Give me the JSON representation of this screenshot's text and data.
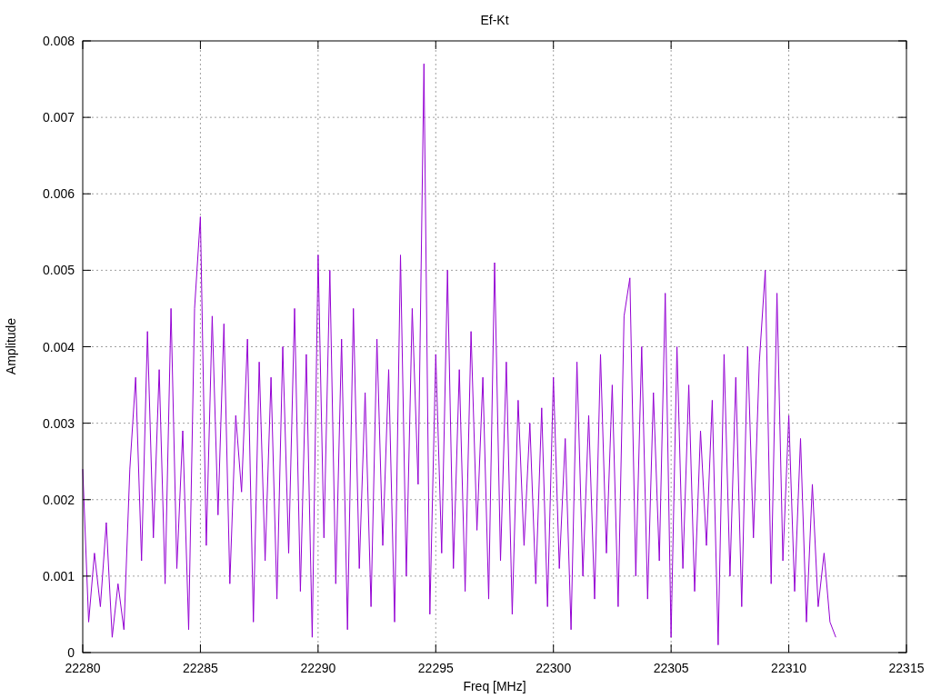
{
  "chart_data": {
    "type": "line",
    "title": "Ef-Kt",
    "xlabel": "Freq [MHz]",
    "ylabel": "Amplitude",
    "xlim": [
      22280,
      22315
    ],
    "ylim": [
      0,
      0.008
    ],
    "xticks": [
      22280,
      22285,
      22290,
      22295,
      22300,
      22305,
      22310,
      22315
    ],
    "yticks": [
      {
        "value": 0,
        "label": "0"
      },
      {
        "value": 0.001,
        "label": "0.001"
      },
      {
        "value": 0.002,
        "label": "0.002"
      },
      {
        "value": 0.003,
        "label": "0.003"
      },
      {
        "value": 0.004,
        "label": "0.004"
      },
      {
        "value": 0.005,
        "label": "0.005"
      },
      {
        "value": 0.006,
        "label": "0.006"
      },
      {
        "value": 0.007,
        "label": "0.007"
      },
      {
        "value": 0.008,
        "label": "0.008"
      }
    ],
    "grid": true,
    "x": [
      22280,
      22280.25,
      22280.5,
      22280.75,
      22281,
      22281.25,
      22281.5,
      22281.75,
      22282,
      22282.25,
      22282.5,
      22282.75,
      22283,
      22283.25,
      22283.5,
      22283.75,
      22284,
      22284.25,
      22284.5,
      22284.75,
      22285,
      22285.25,
      22285.5,
      22285.75,
      22286,
      22286.25,
      22286.5,
      22286.75,
      22287,
      22287.25,
      22287.5,
      22287.75,
      22288,
      22288.25,
      22288.5,
      22288.75,
      22289,
      22289.25,
      22289.5,
      22289.75,
      22290,
      22290.25,
      22290.5,
      22290.75,
      22291,
      22291.25,
      22291.5,
      22291.75,
      22292,
      22292.25,
      22292.5,
      22292.75,
      22293,
      22293.25,
      22293.5,
      22293.75,
      22294,
      22294.25,
      22294.5,
      22294.75,
      22295,
      22295.25,
      22295.5,
      22295.75,
      22296,
      22296.25,
      22296.5,
      22296.75,
      22297,
      22297.25,
      22297.5,
      22297.75,
      22298,
      22298.25,
      22298.5,
      22298.75,
      22299,
      22299.25,
      22299.5,
      22299.75,
      22300,
      22300.25,
      22300.5,
      22300.75,
      22301,
      22301.25,
      22301.5,
      22301.75,
      22302,
      22302.25,
      22302.5,
      22302.75,
      22303,
      22303.25,
      22303.5,
      22303.75,
      22304,
      22304.25,
      22304.5,
      22304.75,
      22305,
      22305.25,
      22305.5,
      22305.75,
      22306,
      22306.25,
      22306.5,
      22306.75,
      22307,
      22307.25,
      22307.5,
      22307.75,
      22308,
      22308.25,
      22308.5,
      22308.75,
      22309,
      22309.25,
      22309.5,
      22309.75,
      22310,
      22310.25,
      22310.5,
      22310.75,
      22311,
      22311.25,
      22311.5,
      22311.75,
      22312
    ],
    "series": [
      {
        "color": "#9400d3",
        "values": [
          0.0024,
          0.0004,
          0.0013,
          0.0006,
          0.0017,
          0.0002,
          0.0009,
          0.0003,
          0.0024,
          0.0036,
          0.0012,
          0.0042,
          0.0015,
          0.0037,
          0.0009,
          0.0045,
          0.0011,
          0.0029,
          0.0003,
          0.0045,
          0.0057,
          0.0014,
          0.0044,
          0.0018,
          0.0043,
          0.0009,
          0.0031,
          0.0021,
          0.0041,
          0.0004,
          0.0038,
          0.0012,
          0.0036,
          0.0007,
          0.004,
          0.0013,
          0.0045,
          0.0008,
          0.0039,
          0.0002,
          0.0052,
          0.0015,
          0.005,
          0.0009,
          0.0041,
          0.0003,
          0.0045,
          0.0011,
          0.0034,
          0.0006,
          0.0041,
          0.0014,
          0.0037,
          0.0004,
          0.0052,
          0.001,
          0.0045,
          0.0022,
          0.0077,
          0.0005,
          0.0039,
          0.0013,
          0.005,
          0.0011,
          0.0037,
          0.0008,
          0.0042,
          0.0016,
          0.0036,
          0.0007,
          0.0051,
          0.0012,
          0.0038,
          0.0005,
          0.0033,
          0.0014,
          0.003,
          0.0009,
          0.0032,
          0.0006,
          0.0036,
          0.0011,
          0.0028,
          0.0003,
          0.0038,
          0.001,
          0.0031,
          0.0007,
          0.0039,
          0.0013,
          0.0035,
          0.0006,
          0.0044,
          0.0049,
          0.001,
          0.004,
          0.0007,
          0.0034,
          0.0012,
          0.0047,
          0.0002,
          0.004,
          0.0011,
          0.0035,
          0.0008,
          0.0029,
          0.0014,
          0.0033,
          0.0001,
          0.0039,
          0.001,
          0.0036,
          0.0006,
          0.004,
          0.0015,
          0.0038,
          0.005,
          0.0009,
          0.0047,
          0.0012,
          0.0031,
          0.0008,
          0.0028,
          0.0004,
          0.0022,
          0.0006,
          0.0013,
          0.0004,
          0.0002
        ]
      }
    ]
  }
}
